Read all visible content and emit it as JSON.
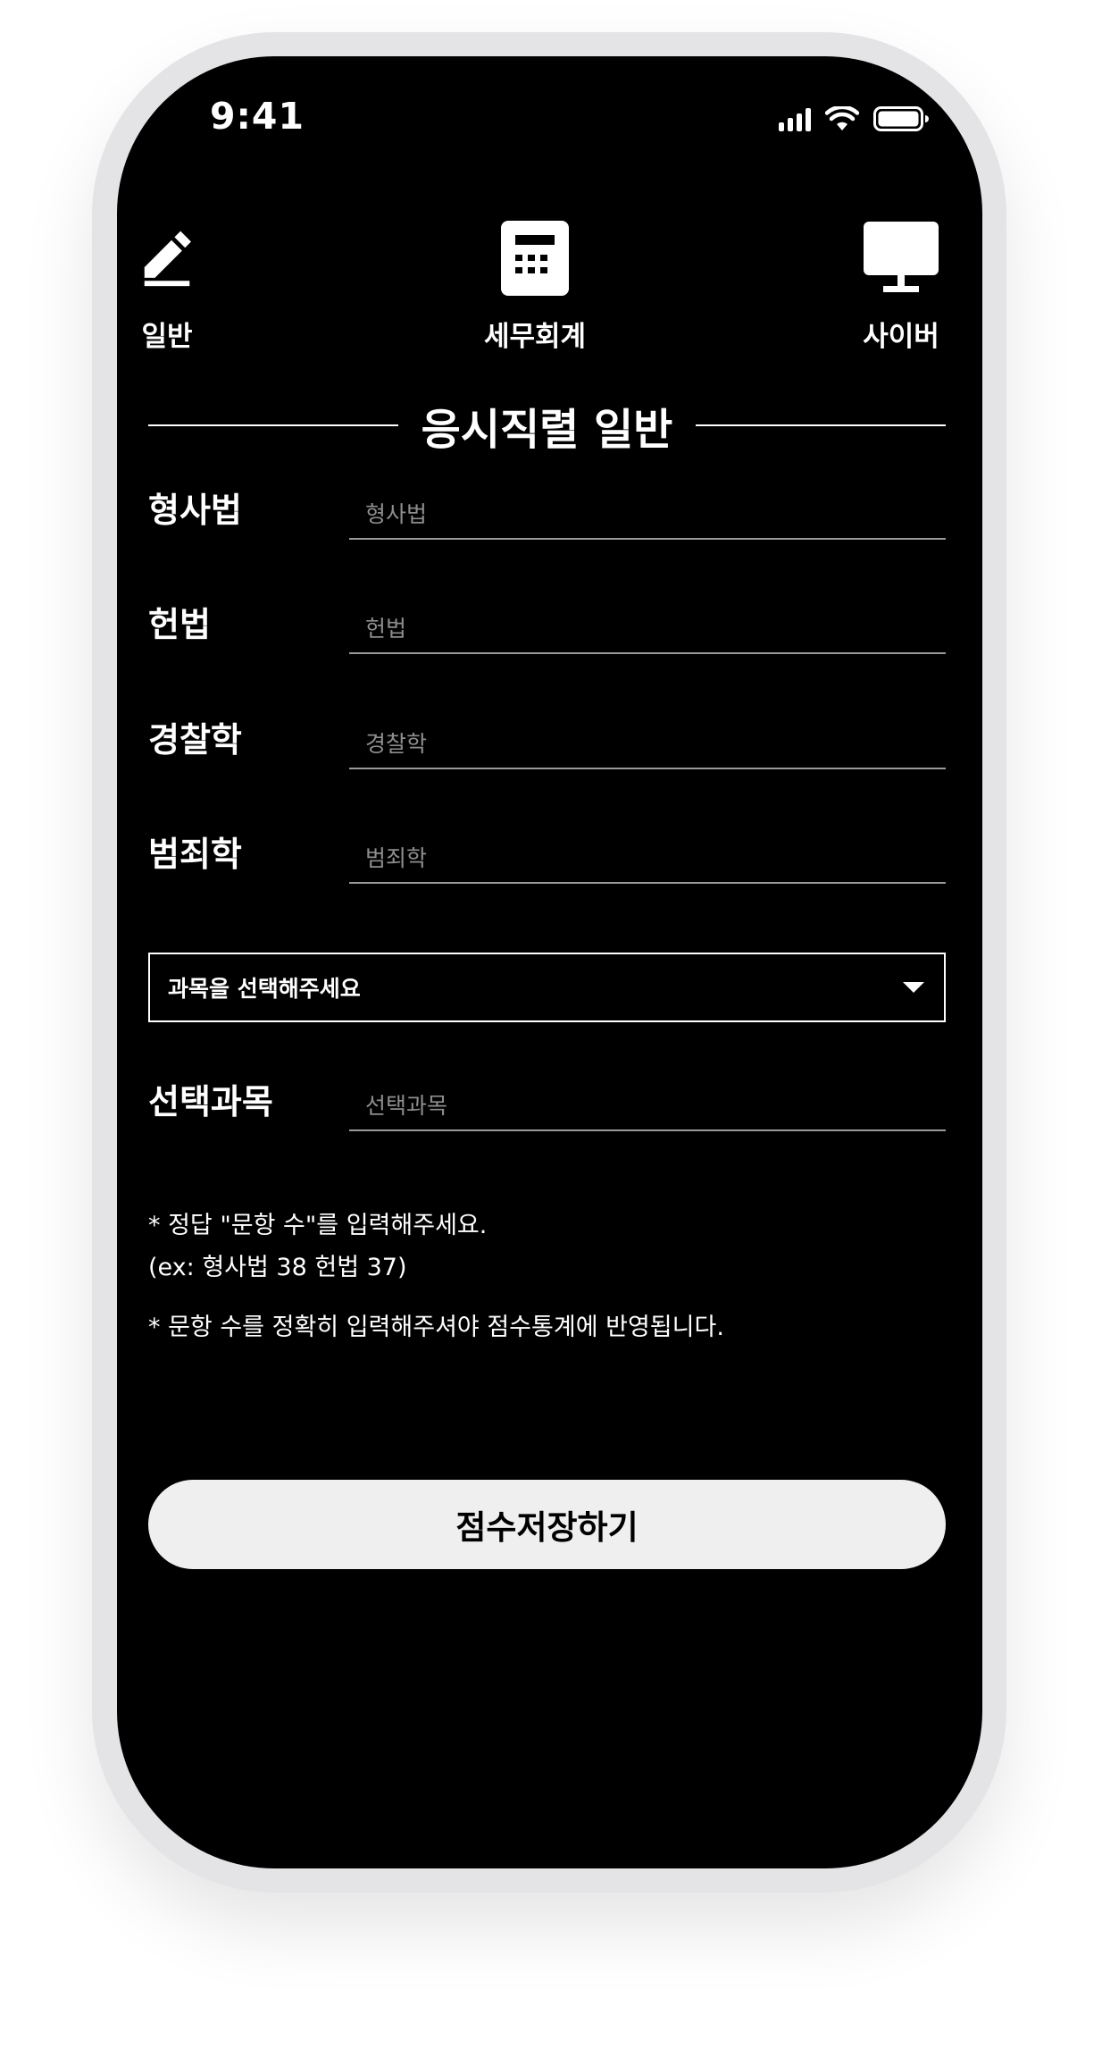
{
  "status_bar": {
    "time": "9:41",
    "signal_icon": "cellular-signal-icon",
    "wifi_icon": "wifi-icon",
    "battery_icon": "battery-icon"
  },
  "categories": [
    {
      "label": "일반",
      "icon": "pencil-icon"
    },
    {
      "label": "세무회계",
      "icon": "calculator-icon"
    },
    {
      "label": "사이버",
      "icon": "monitor-icon"
    }
  ],
  "section_title": "응시직렬 일반",
  "fields": [
    {
      "label": "형사법",
      "placeholder": "형사법"
    },
    {
      "label": "헌법",
      "placeholder": "헌법"
    },
    {
      "label": "경찰학",
      "placeholder": "경찰학"
    },
    {
      "label": "범죄학",
      "placeholder": "범죄학"
    }
  ],
  "subject_select": {
    "selected": "과목을 선택해주세요"
  },
  "elective": {
    "label": "선택과목",
    "placeholder": "선택과목"
  },
  "notes": [
    "* 정답 \"문항 수\"를 입력해주세요.",
    "(ex: 형사법 38 헌법 37)",
    "* 문항 수를 정확히 입력해주셔야 점수통계에 반영됩니다."
  ],
  "save_button": "점수저장하기",
  "colors": {
    "screen_bg": "#000000",
    "text": "#ffffff",
    "button_bg": "#efefef",
    "placeholder": "#8e8e8e",
    "underline": "#9a9a9a"
  }
}
